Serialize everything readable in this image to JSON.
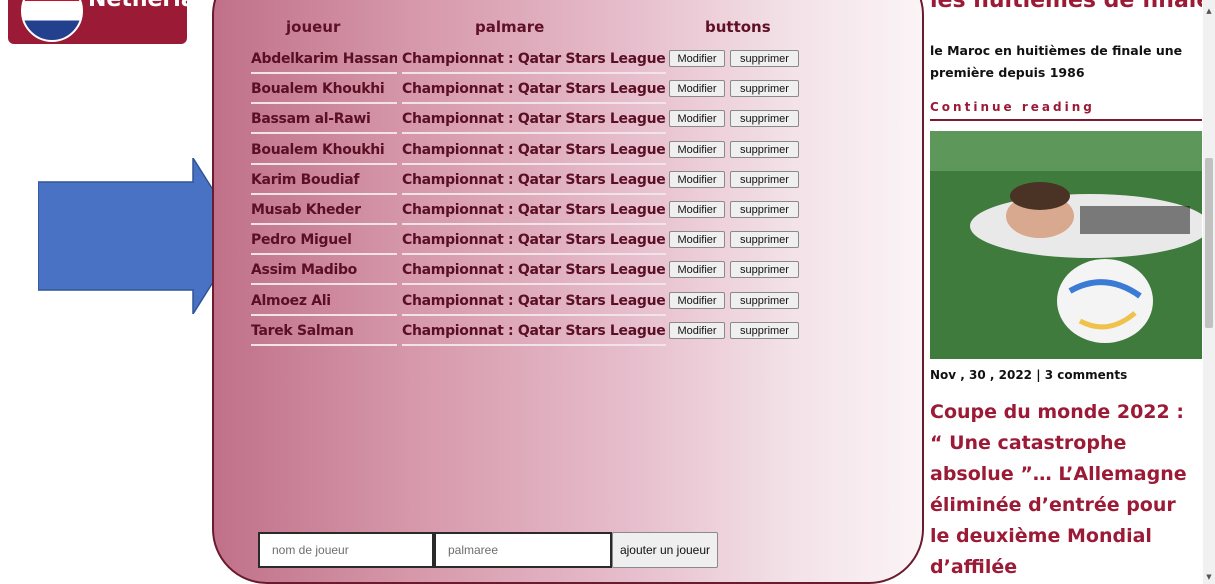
{
  "flag_card": {
    "country_label": "Netherlands"
  },
  "table": {
    "headers": {
      "player": "joueur",
      "palmares": "palmare",
      "buttons": "buttons"
    },
    "rows": [
      {
        "player": "Abdelkarim Hassan",
        "palmares": "Championnat : Qatar Stars League",
        "edit": "Modifier",
        "delete": "supprimer"
      },
      {
        "player": "Boualem Khoukhi",
        "palmares": "Championnat : Qatar Stars League",
        "edit": "Modifier",
        "delete": "supprimer"
      },
      {
        "player": "Bassam al-Rawi",
        "palmares": "Championnat : Qatar Stars League",
        "edit": "Modifier",
        "delete": "supprimer"
      },
      {
        "player": "Boualem Khoukhi",
        "palmares": "Championnat : Qatar Stars League",
        "edit": "Modifier",
        "delete": "supprimer"
      },
      {
        "player": "Karim Boudiaf",
        "palmares": "Championnat : Qatar Stars League",
        "edit": "Modifier",
        "delete": "supprimer"
      },
      {
        "player": "Musab Kheder",
        "palmares": "Championnat : Qatar Stars League",
        "edit": "Modifier",
        "delete": "supprimer"
      },
      {
        "player": "Pedro Miguel",
        "palmares": "Championnat : Qatar Stars League",
        "edit": "Modifier",
        "delete": "supprimer"
      },
      {
        "player": "Assim Madibo",
        "palmares": "Championnat : Qatar Stars League",
        "edit": "Modifier",
        "delete": "supprimer"
      },
      {
        "player": "Almoez Ali",
        "palmares": "Championnat : Qatar Stars League",
        "edit": "Modifier",
        "delete": "supprimer"
      },
      {
        "player": "Tarek Salman",
        "palmares": "Championnat : Qatar Stars League",
        "edit": "Modifier",
        "delete": "supprimer"
      }
    ]
  },
  "form": {
    "player_placeholder": "nom de joueur",
    "palmares_placeholder": "palmaree",
    "add_label": "ajouter un joueur"
  },
  "aside": {
    "cut_title": "les huitièmes de finale.",
    "excerpt": "le Maroc en huitièmes de finale une première depuis 1986",
    "continue": "Continue reading",
    "meta": "Nov , 30 , 2022 | 3 comments",
    "headline": "Coupe du monde 2022 : “ Une catastrophe absolue ”… L’Allemagne éliminée d’entrée pour le deuxième Mondial d’affilée"
  },
  "colors": {
    "accent": "#9b1b37",
    "arrow": "#4a72c4",
    "table_text": "#5a0f25"
  }
}
